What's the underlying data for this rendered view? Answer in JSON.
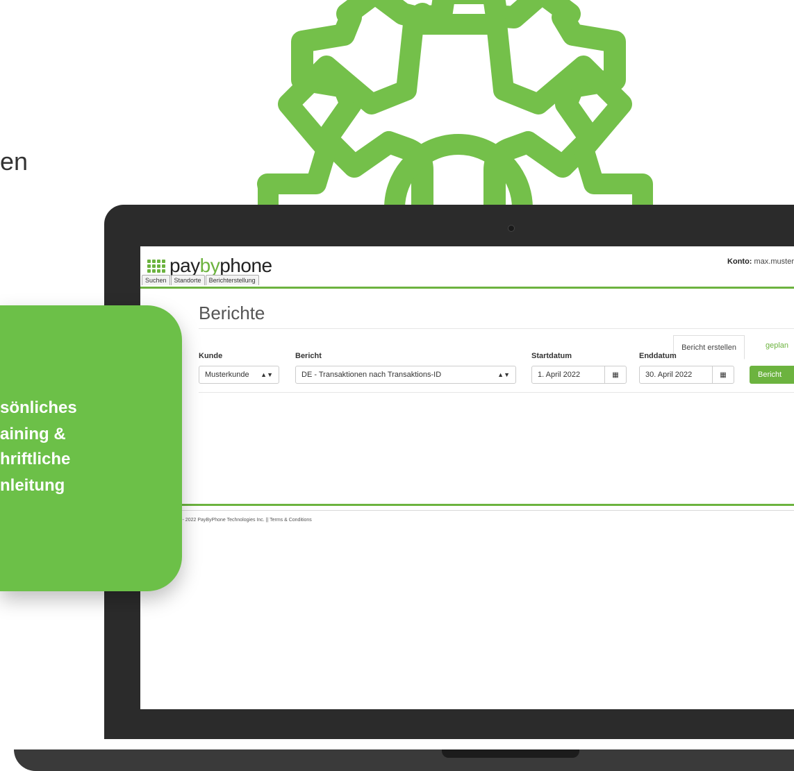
{
  "background_text": "en",
  "card": {
    "lines": [
      "sönliches",
      "aining &",
      "hriftliche",
      "nleitung"
    ]
  },
  "app": {
    "logo": {
      "part1": "pay",
      "part2": "by",
      "part3": "phone"
    },
    "account": {
      "label": "Konto:",
      "value": "max.muster"
    },
    "nav_tabs": [
      "Suchen",
      "Standorte",
      "Berichterstellung"
    ],
    "page_title": "Berichte",
    "tabs": {
      "create": "Bericht erstellen",
      "scheduled": "geplan"
    },
    "form": {
      "customer": {
        "label": "Kunde",
        "value": "Musterkunde"
      },
      "report": {
        "label": "Bericht",
        "value": "DE - Transaktionen nach Transaktions-ID"
      },
      "start": {
        "label": "Startdatum",
        "value": "1. April 2022"
      },
      "end": {
        "label": "Enddatum",
        "value": "30. April 2022"
      },
      "submit": "Bericht"
    },
    "footer": "Copyright © 2005 - 2022 PayByPhone Technologies Inc. || Terms & Conditions"
  },
  "colors": {
    "accent": "#6cb33f",
    "card": "#6cc048",
    "laptop": "#2b2b2b"
  }
}
